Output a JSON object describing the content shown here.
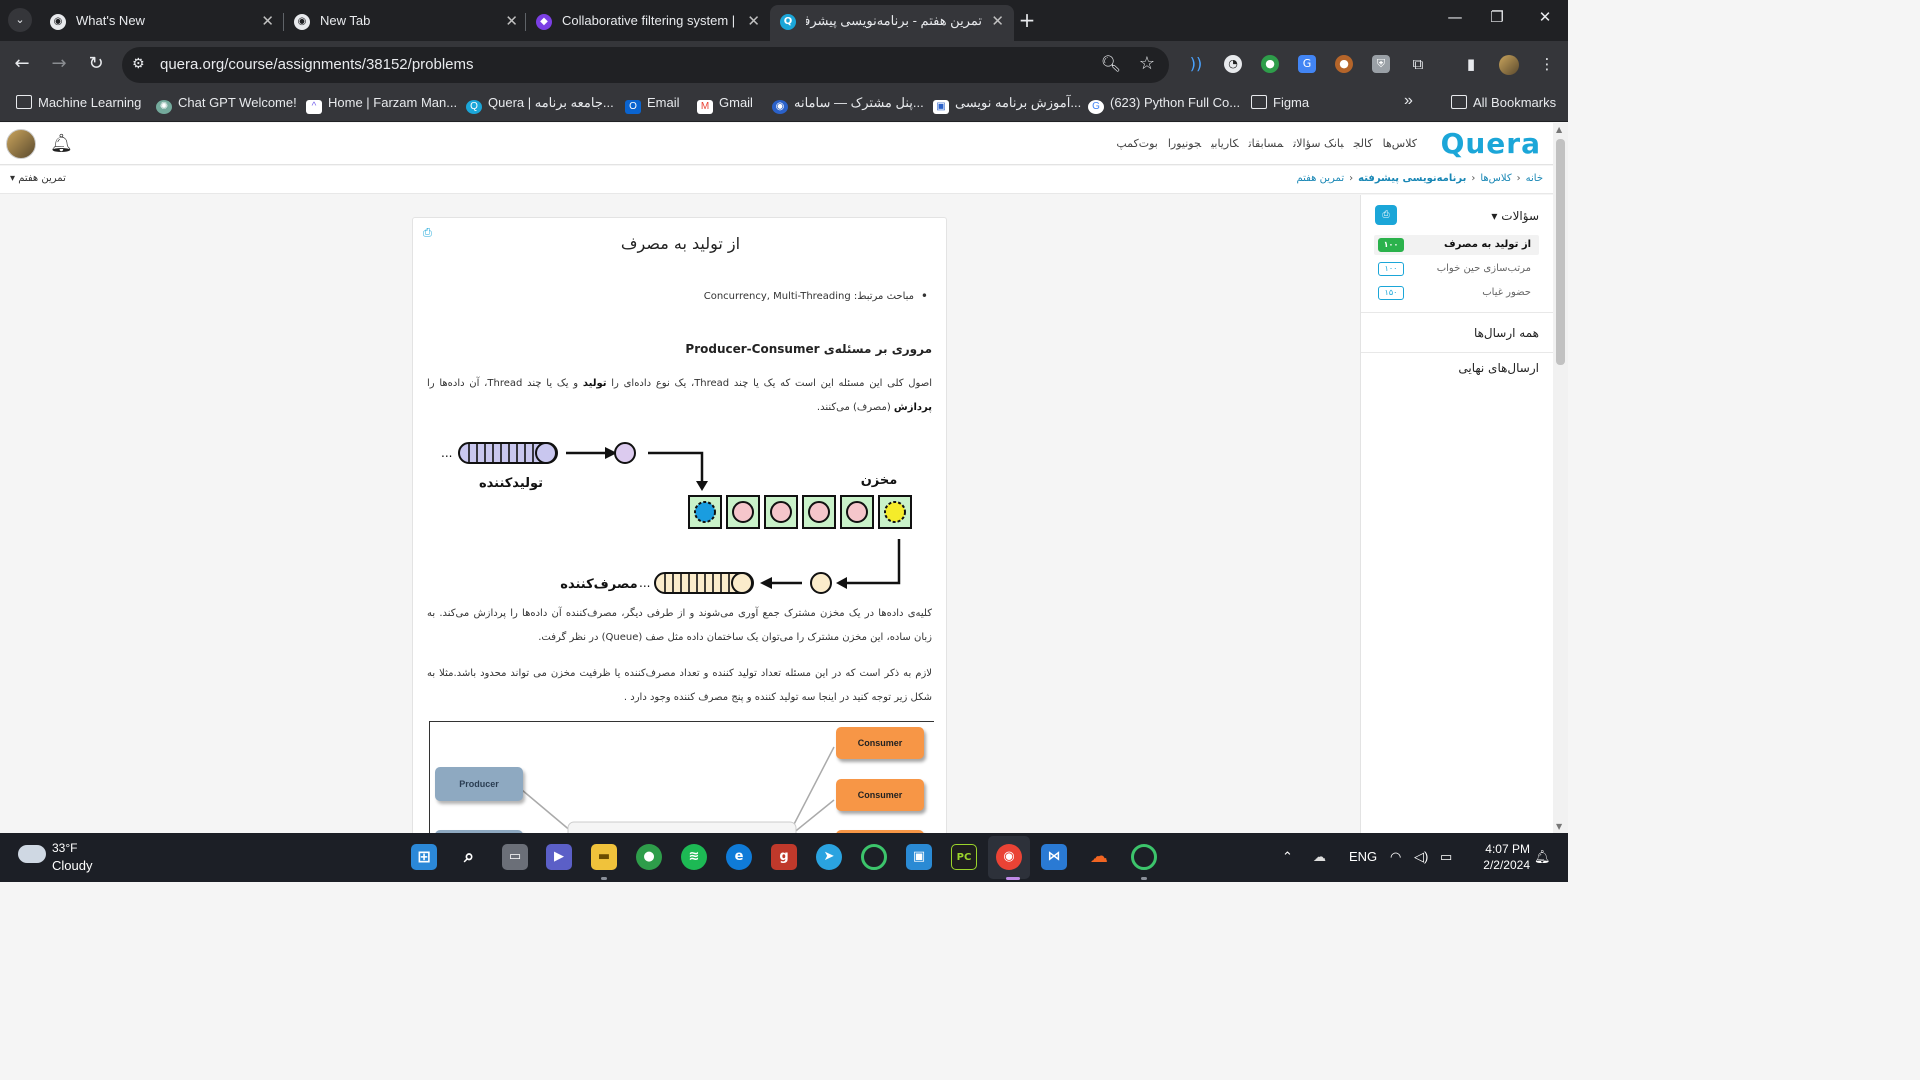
{
  "browser": {
    "tabs": [
      {
        "title": "What's New",
        "icon": "chrome-icon"
      },
      {
        "title": "New Tab",
        "icon": "chrome-icon"
      },
      {
        "title": "Collaborative filtering system | C",
        "icon": "obsidian-icon"
      },
      {
        "title": "تمرین هفتم - برنامه‌نویسی پیشرفته",
        "icon": "quera-icon"
      }
    ],
    "url": "quera.org/course/assignments/38152/problems",
    "bookmarks": [
      {
        "label": "Machine Learning",
        "icon": "folder-icon"
      },
      {
        "label": "Chat GPT Welcome!",
        "icon": "chatgpt-icon"
      },
      {
        "label": "Home | Farzam Man...",
        "icon": "clickup-icon"
      },
      {
        "label": "Quera | جامعه برنامه...",
        "icon": "quera-icon"
      },
      {
        "label": "Email",
        "icon": "outlook-icon"
      },
      {
        "label": "Gmail",
        "icon": "gmail-icon"
      },
      {
        "label": "پنل مشترک — سامانه...",
        "icon": "bank-icon"
      },
      {
        "label": "آموزش برنامه نویسی...",
        "icon": "course-icon"
      },
      {
        "label": "(623) Python Full Co...",
        "icon": "google-icon"
      },
      {
        "label": "Figma",
        "icon": "folder-icon"
      }
    ],
    "more_bookmarks": "»",
    "all_bookmarks": "All Bookmarks"
  },
  "site": {
    "logo": "Quera",
    "nav": [
      "کلاس‌ها",
      "کالج",
      "بانک سؤالات",
      "مسابقات",
      "کاریابی",
      "جونیورا",
      "بوت‌کمپ"
    ],
    "breadcrumb": [
      "خانه",
      "کلاس‌ها",
      "برنامه‌نویسی پیشرفته",
      "تمرین هفتم"
    ],
    "assignment_selector": "تمرین هفتم"
  },
  "sidebar": {
    "title": "سؤالات",
    "questions": [
      {
        "name": "از تولید به مصرف",
        "score": "۱۰۰",
        "solved": true
      },
      {
        "name": "مرتب‌سازی حین خواب",
        "score": "۱۰۰",
        "solved": false
      },
      {
        "name": "حضور غیاب",
        "score": "۱۵۰",
        "solved": false
      }
    ],
    "all_submissions": "همه ارسال‌ها",
    "final_submissions": "ارسال‌های نهایی"
  },
  "problem": {
    "title": "از تولید به مصرف",
    "topics_label": "مباحث مرتبط:",
    "topics": "Concurrency, Multi-Threading",
    "section_title": "مروری بر مسئله‌ی Producer-Consumer",
    "p1_a": "اصول کلی این مسئله این است که یک یا چند Thread، یک نوع داده‌ای را ",
    "p1_b": "تولید",
    "p1_c": " و یک یا چند Thread، آن داده‌ها را ",
    "p1_d": "پردازش",
    "p1_e": " (مصرف) می‌کنند.",
    "p2": "کلیه‌ی داده‌ها در یک مخزن مشترک جمع آوری می‌شوند و از طرفی دیگر، مصرف‌کننده آن داده‌ها را پردازش می‌کند. به زبان ساده، این مخزن مشترک را می‌توان یک ساختمان داده مثل صف (Queue) در نظر گرفت.",
    "p3": "لازم به ذکر است که در این مسئله تعداد تولید کننده و تعداد مصرف‌کننده یا ظرفیت مخزن می تواند محدود باشد.مثلا به شکل زیر توجه کنید در اینجا سه تولید کننده و پنج مصرف کننده وجود دارد .",
    "diagram1": {
      "producer_label": "تولیدکننده",
      "buffer_label": "مخزن",
      "consumer_label": "مصرف‌کننده",
      "ellipsis": "..."
    },
    "diagram2": {
      "producer_label": "Producer",
      "consumer_label": "Consumer"
    }
  },
  "taskbar": {
    "temperature": "33°F",
    "condition": "Cloudy",
    "language": "ENG",
    "time": "4:07 PM",
    "date": "2/2/2024"
  }
}
